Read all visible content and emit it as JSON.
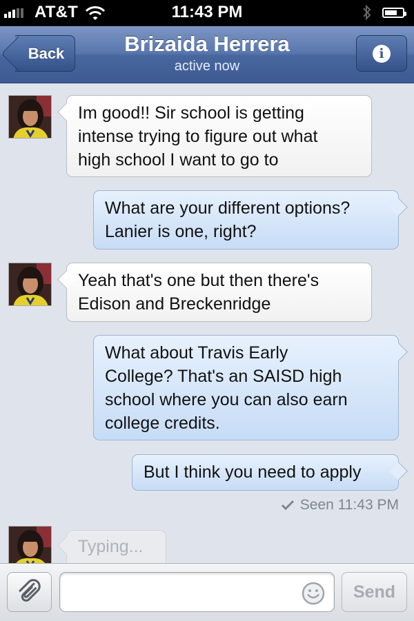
{
  "status_bar": {
    "carrier": "AT&T",
    "time": "11:43 PM",
    "signal_bars": 3,
    "battery_level": 0.7
  },
  "nav": {
    "back_label": "Back",
    "contact_name": "Brizaida Herrera",
    "presence": "active now",
    "info_icon": "info-icon",
    "info_glyph": "i"
  },
  "messages": [
    {
      "direction": "incoming",
      "text": "Im good!! Sir school is getting\nintense trying to figure out what\nhigh school I want to go to"
    },
    {
      "direction": "outgoing",
      "text": "What are your different options?\nLanier is one, right?"
    },
    {
      "direction": "incoming",
      "text": "Yeah that's one but then there's\nEdison and Breckenridge"
    },
    {
      "direction": "outgoing",
      "text": "What about Travis Early\nCollege? That's an SAISD high\nschool where you can also earn\ncollege credits."
    },
    {
      "direction": "outgoing",
      "text": "But I think you need to apply"
    }
  ],
  "seen_receipt": "Seen 11:43 PM",
  "typing_indicator": "Typing...",
  "composer": {
    "input_value": "",
    "input_placeholder": "",
    "send_label": "Send",
    "attach_icon": "paperclip-icon",
    "emoji_icon": "smiley-icon"
  },
  "colors": {
    "nav_bar": "#4f6ea6",
    "incoming_bubble": "#ffffff",
    "outgoing_bubble": "#d6e6fa",
    "thread_background": "#dfe4ec"
  }
}
